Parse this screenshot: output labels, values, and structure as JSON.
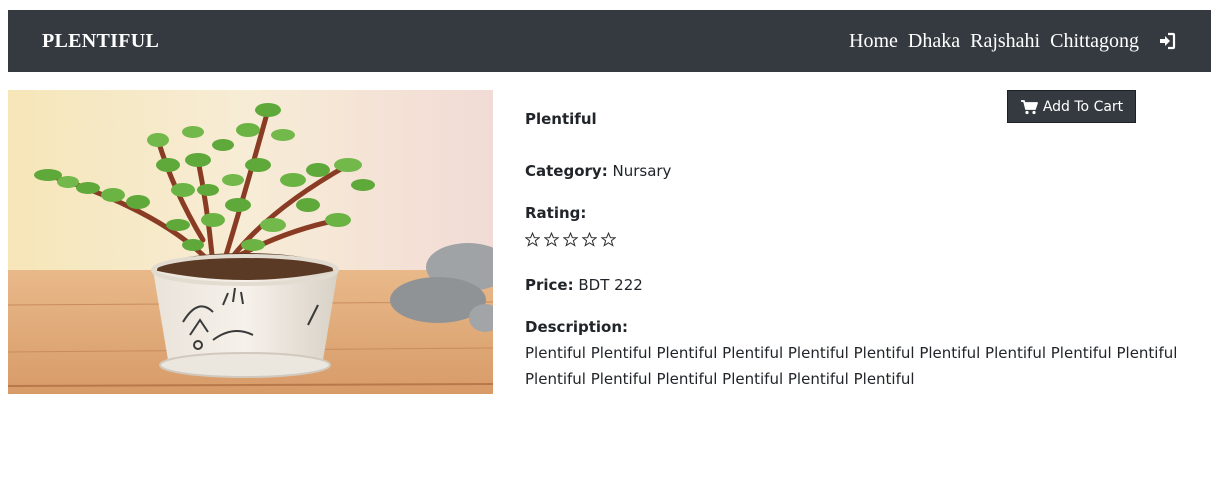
{
  "navbar": {
    "brand": "PLENTIFUL",
    "links": [
      "Home",
      "Dhaka",
      "Rajshahi",
      "Chittagong"
    ],
    "login_icon": "sign-in-icon"
  },
  "product": {
    "name": "Plentiful",
    "image_icon": "jade-plant-in-pot",
    "add_to_cart_label": "Add To Cart",
    "cart_icon": "shopping-cart-icon",
    "category_label": "Category:",
    "category_value": "Nursary",
    "rating_label": "Rating:",
    "rating": 0,
    "rating_max": 5,
    "price_label": "Price:",
    "price_value": "BDT 222",
    "description_label": "Description:",
    "description": "Plentiful Plentiful Plentiful Plentiful Plentiful Plentiful Plentiful Plentiful Plentiful Plentiful Plentiful Plentiful Plentiful Plentiful Plentiful Plentiful"
  },
  "colors": {
    "navbar_bg": "#343a40",
    "button_bg": "#343a40",
    "text": "#212529"
  }
}
